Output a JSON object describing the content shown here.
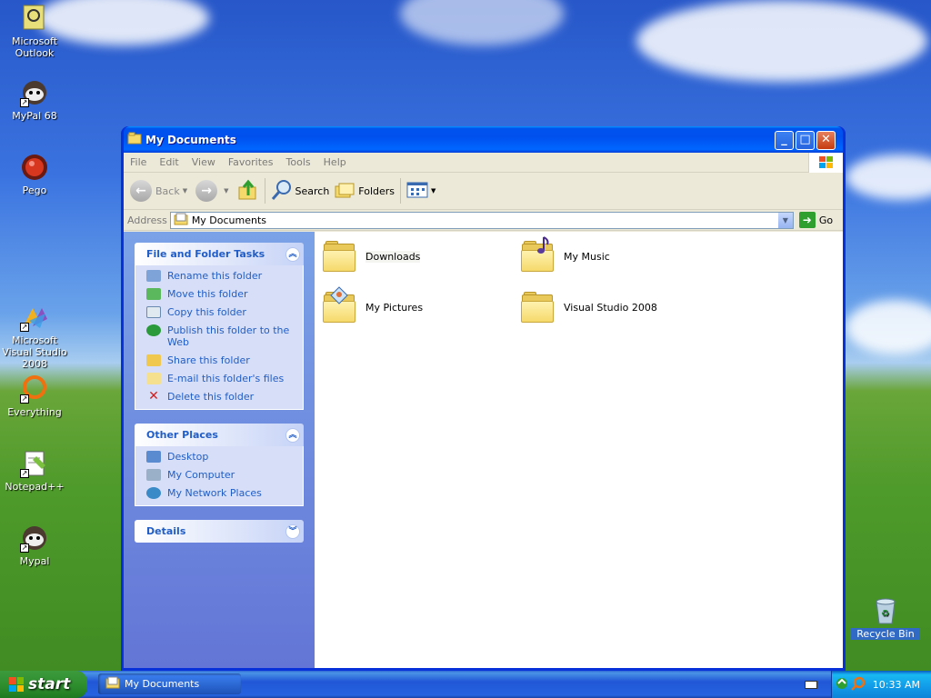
{
  "desktop": {
    "icons": [
      {
        "label": "Microsoft Outlook",
        "icon": "outlook-icon"
      },
      {
        "label": "MyPal 68",
        "icon": "mypal-icon"
      },
      {
        "label": "Pego",
        "icon": "pego-icon"
      },
      {
        "label": "Microsoft Visual Studio 2008",
        "icon": "visual-studio-icon"
      },
      {
        "label": "Everything",
        "icon": "everything-icon"
      },
      {
        "label": "Notepad++",
        "icon": "notepad-plus-plus-icon"
      },
      {
        "label": "Mypal",
        "icon": "mypal-icon"
      },
      {
        "label": "Recycle Bin",
        "icon": "recycle-bin-icon"
      }
    ]
  },
  "window": {
    "title": "My Documents",
    "menu": [
      "File",
      "Edit",
      "View",
      "Favorites",
      "Tools",
      "Help"
    ],
    "toolbar": {
      "back": "Back",
      "search": "Search",
      "folders": "Folders"
    },
    "address": {
      "label": "Address",
      "value": "My Documents",
      "go": "Go"
    },
    "tasks": {
      "file_folder": {
        "title": "File and Folder Tasks",
        "items": [
          "Rename this folder",
          "Move this folder",
          "Copy this folder",
          "Publish this folder to the Web",
          "Share this folder",
          "E-mail this folder's files",
          "Delete this folder"
        ]
      },
      "other_places": {
        "title": "Other Places",
        "items": [
          "Desktop",
          "My Computer",
          "My Network Places"
        ]
      },
      "details": {
        "title": "Details"
      }
    },
    "content": {
      "items": [
        "Downloads",
        "My Music",
        "My Pictures",
        "Visual Studio 2008"
      ]
    }
  },
  "taskbar": {
    "start": "start",
    "task": "My Documents",
    "clock": "10:33 AM"
  },
  "colors": {
    "title_bar": "#0054e3",
    "task_link": "#215dc6",
    "start_green": "#2f8f2f"
  }
}
